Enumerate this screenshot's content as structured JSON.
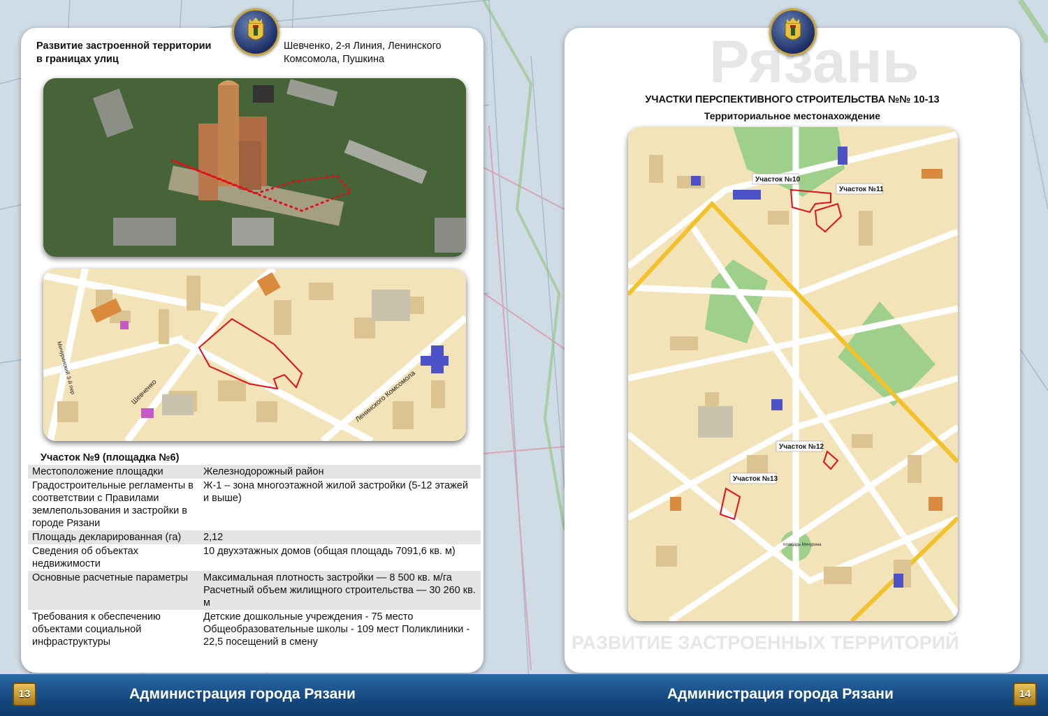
{
  "left": {
    "title_line1": "Развитие застроенной территории",
    "title_line2": "в границах улиц",
    "streets_line1": "Шевченко, 2-я Линия, Ленинского",
    "streets_line2": "Комсомола, Пушкина",
    "map_labels": {
      "street1": "Шевченко",
      "street2": "Ленинского Комсомола",
      "street3": "Мичуринский 3-й пер"
    },
    "site_title": "Участок №9 (площадка №6)",
    "rows": [
      {
        "key": "Местоположение площадки",
        "value": "Железнодорожный район"
      },
      {
        "key": "Градостроительные регламенты в соответствии с Правилами землепользования и застройки в городе Рязани",
        "value": "Ж-1 – зона многоэтажной жилой застройки (5-12 этажей и выше)"
      },
      {
        "key": "Площадь декларированная (га)",
        "value": "2,12"
      },
      {
        "key": "Сведения об объектах недвижимости",
        "value": "10 двухэтажных домов (общая площадь 7091,6 кв. м)"
      },
      {
        "key": "Основные расчетные параметры",
        "value": "Максимальная плотность застройки — 8 500 кв. м/га Расчетный объем жилищного строительства — 30 260 кв. м"
      },
      {
        "key": "Требования к обеспечению объектами социальной инфраструктуры",
        "value": "Детские дошкольные учреждения - 75 место Общеобразовательные школы - 109 мест Поликлиники - 22,5 посещений в смену"
      }
    ]
  },
  "right": {
    "title": "УЧАСТКИ ПЕРСПЕКТИВНОГО СТРОИТЕЛЬСТВА №№ 10-13",
    "subtitle": "Территориальное местонахождение",
    "markers": [
      "Участок №10",
      "Участок №11",
      "Участок №12",
      "Участок №13"
    ],
    "square_label": "площадь Мичурина"
  },
  "watermarks": {
    "city": "Рязань",
    "theme": "РАЗВИТИЕ ЗАСТРОЕННЫХ ТЕРРИТОРИЙ"
  },
  "footer": {
    "left_text": "Администрация города Рязани",
    "right_text": "Администрация города Рязани",
    "left_page": "13",
    "right_page": "14"
  },
  "colors": {
    "footer": "#164a82",
    "boundary": "#e0101a",
    "map_block": "#f3e3b8",
    "road_yellow": "#f2c22c",
    "park": "#9ed08b"
  }
}
